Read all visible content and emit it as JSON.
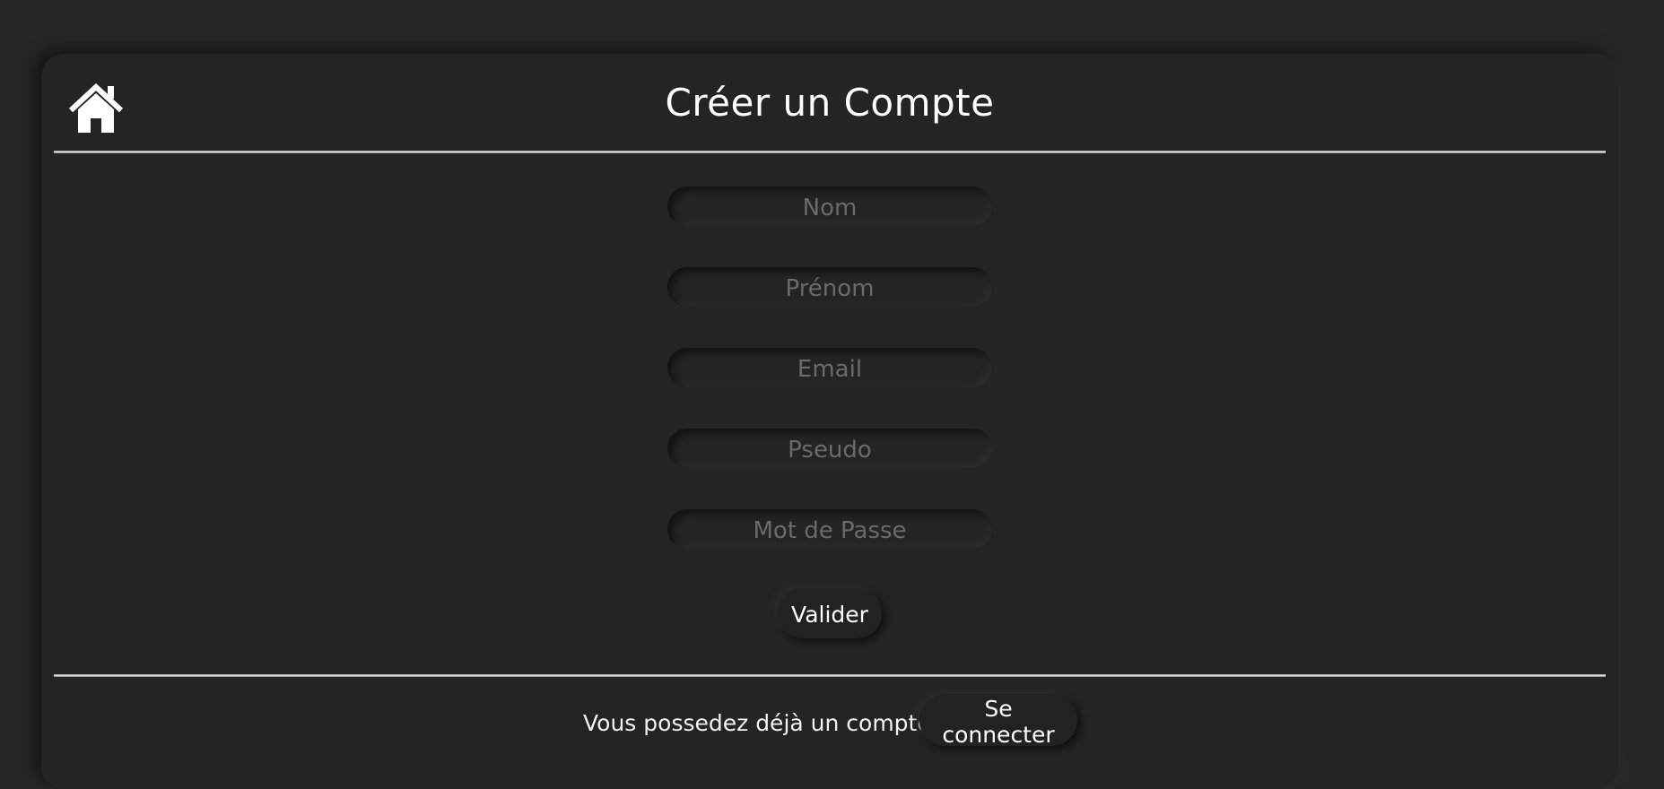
{
  "header": {
    "title": "Créer un Compte",
    "home_icon": "home-icon"
  },
  "form": {
    "fields": [
      {
        "name": "nom",
        "placeholder": "Nom",
        "value": ""
      },
      {
        "name": "prenom",
        "placeholder": "Prénom",
        "value": ""
      },
      {
        "name": "email",
        "placeholder": "Email",
        "value": ""
      },
      {
        "name": "pseudo",
        "placeholder": "Pseudo",
        "value": ""
      },
      {
        "name": "password",
        "placeholder": "Mot de Passe",
        "value": ""
      }
    ],
    "submit_label": "Valider"
  },
  "footer": {
    "prompt_text": "Vous possedez déjà un compte ?",
    "login_label": "Se connecter"
  },
  "colors": {
    "background": "#262626",
    "card": "#242424",
    "text": "#ffffff",
    "placeholder": "#6a6a6a"
  }
}
